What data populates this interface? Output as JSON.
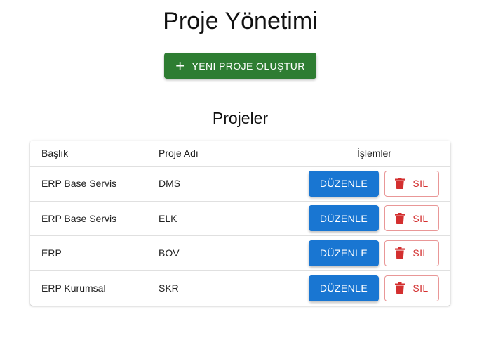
{
  "page": {
    "title": "Proje Yönetimi",
    "create_button_label": "YENI PROJE OLUŞTUR",
    "create_button_icon": "plus-icon",
    "section_title": "Projeler"
  },
  "table": {
    "headers": {
      "title": "Başlık",
      "project_name": "Proje Adı",
      "actions": "İşlemler"
    },
    "rows": [
      {
        "title": "ERP Base Servis",
        "project_name": "DMS",
        "edit_label": "DÜZENLE",
        "delete_label": "SIL"
      },
      {
        "title": "ERP Base Servis",
        "project_name": "ELK",
        "edit_label": "DÜZENLE",
        "delete_label": "SIL"
      },
      {
        "title": "ERP",
        "project_name": "BOV",
        "edit_label": "DÜZENLE",
        "delete_label": "SIL"
      },
      {
        "title": "ERP Kurumsal",
        "project_name": "SKR",
        "edit_label": "DÜZENLE",
        "delete_label": "SIL"
      }
    ]
  },
  "colors": {
    "create_button": "#2e7d32",
    "edit_button": "#1976d2",
    "delete_accent": "#d32f2f"
  },
  "icons": {
    "delete": "trash-icon",
    "create": "plus-icon"
  }
}
